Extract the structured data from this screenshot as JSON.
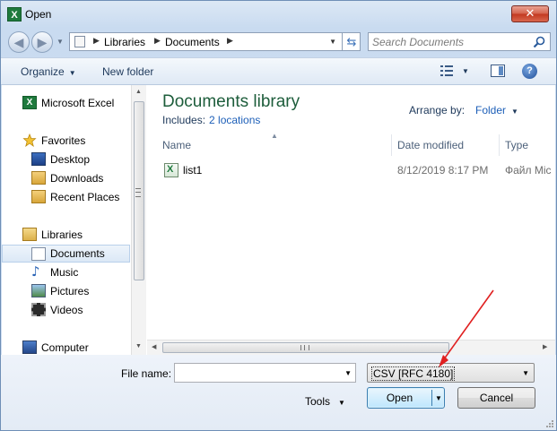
{
  "window": {
    "title": "Open",
    "close_label": "✕"
  },
  "address": {
    "crumbs": [
      "Libraries",
      "Documents"
    ],
    "search_placeholder": "Search Documents"
  },
  "toolbar": {
    "organize_label": "Organize",
    "new_folder_label": "New folder"
  },
  "nav": {
    "items": [
      {
        "label": "Microsoft Excel",
        "icon": "excel-icon"
      },
      {
        "label": "Favorites",
        "icon": "star-icon"
      },
      {
        "label": "Desktop",
        "icon": "desktop-icon"
      },
      {
        "label": "Downloads",
        "icon": "downloads-icon"
      },
      {
        "label": "Recent Places",
        "icon": "recent-places-icon"
      },
      {
        "label": "Libraries",
        "icon": "libraries-icon"
      },
      {
        "label": "Documents",
        "icon": "documents-icon",
        "selected": true
      },
      {
        "label": "Music",
        "icon": "music-icon"
      },
      {
        "label": "Pictures",
        "icon": "pictures-icon"
      },
      {
        "label": "Videos",
        "icon": "videos-icon"
      },
      {
        "label": "Computer",
        "icon": "computer-icon"
      }
    ]
  },
  "library": {
    "title": "Documents library",
    "includes_label": "Includes:",
    "includes_link": "2 locations",
    "arrange_label": "Arrange by:",
    "arrange_value": "Folder"
  },
  "columns": {
    "name": "Name",
    "date_modified": "Date modified",
    "type": "Type"
  },
  "files": [
    {
      "name": "list1",
      "date_modified": "8/12/2019 8:17 PM",
      "type": "Файл Mic"
    }
  ],
  "bottom": {
    "file_name_label": "File name:",
    "file_name_value": "",
    "file_type_value": "CSV [RFC 4180]",
    "tools_label": "Tools",
    "open_label": "Open",
    "cancel_label": "Cancel"
  },
  "colors": {
    "accent": "#1d5fb8",
    "annotation_arrow": "#e02020"
  }
}
